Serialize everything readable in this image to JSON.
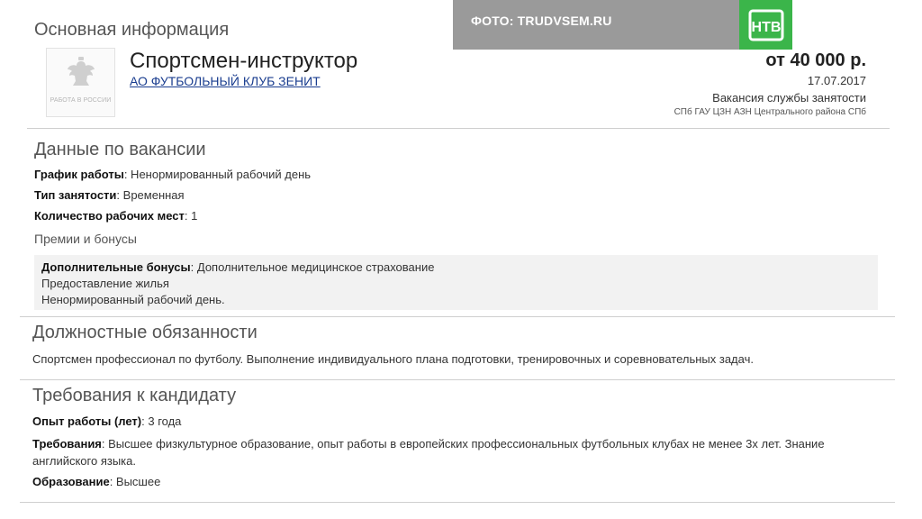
{
  "overlay": {
    "photo_credit": "ФОТО: TRUDVSEM.RU",
    "channel_logo_text": "НТВ",
    "channel_logo_color": "#3bb54a"
  },
  "basic_info": {
    "heading": "Основная информация",
    "logo_caption": "РАБОТА В РОССИИ",
    "job_title": "Спортсмен-инструктор",
    "company": "АО ФУТБОЛЬНЫЙ КЛУБ ЗЕНИТ",
    "salary": "от 40 000 р.",
    "date": "17.07.2017",
    "vacancy_source": "Вакансия службы занятости",
    "agency": "СПб ГАУ ЦЗН АЗН Центрального района СПб"
  },
  "vacancy_data": {
    "heading": "Данные по вакансии",
    "schedule_label": "График работы",
    "schedule_value": ": Ненормированный рабочий день",
    "employment_label": "Тип занятости",
    "employment_value": ": Временная",
    "positions_label": "Количество рабочих мест",
    "positions_value": ": 1",
    "bonuses_heading": "Премии и бонусы",
    "bonus_label": "Дополнительные бонусы",
    "bonus_value": ": Дополнительное медицинское страхование",
    "bonus_line2": "Предоставление жилья",
    "bonus_line3": "Ненормированный рабочий день."
  },
  "duties": {
    "heading": "Должностные обязанности",
    "text": "Спортсмен профессионал по футболу. Выполнение индивидуального плана подготовки, тренировочных и соревновательных задач."
  },
  "requirements": {
    "heading": "Требования к кандидату",
    "experience_label": "Опыт работы (лет)",
    "experience_value": ": 3 года",
    "req_label": "Требования",
    "req_value": ": Высшее физкультурное образование, опыт работы в европейских профессиональных футбольных клубах не менее 3х лет. Знание английского языка.",
    "education_label": "Образование",
    "education_value": ": Высшее"
  }
}
